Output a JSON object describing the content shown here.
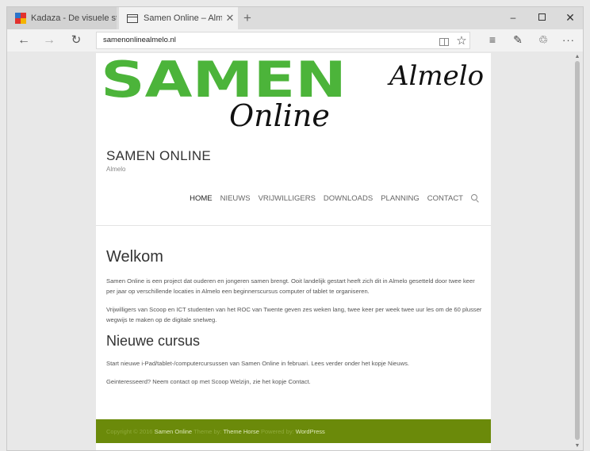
{
  "browser": {
    "tabs": [
      {
        "title": "Kadaza - De visuele startpag",
        "active": false
      },
      {
        "title": "Samen Online – Almelo",
        "active": true
      }
    ],
    "new_tab": "+",
    "url": "samenonlinealmelo.nl",
    "window_controls": {
      "minimize": "–",
      "close": "✕"
    }
  },
  "site": {
    "logo": {
      "big_text": "SAMEN",
      "script_text": "Online",
      "city_text": "Almelo"
    },
    "title": "SAMEN ONLINE",
    "tagline": "Almelo",
    "menu": [
      "HOME",
      "NIEUWS",
      "VRIJWILLIGERS",
      "DOWNLOADS",
      "PLANNING",
      "CONTACT"
    ],
    "content": {
      "heading1": "Welkom",
      "para1": "Samen Online is een project dat ouderen en jongeren samen brengt. Ooit landelijk gestart heeft zich dit in Almelo  gesetteld door twee keer per jaar op verschillende locaties in Almelo een beginnerscursus computer of tablet te organiseren.",
      "para2": "Vrijwilligers van Scoop en ICT studenten van het ROC van Twente geven zes weken lang, twee keer per week twee uur les om de 60 plusser wegwijs te maken op de digitale snelweg.",
      "heading2": "Nieuwe cursus",
      "para3": "Start nieuwe i-Pad/tablet-/computercursussen van Samen Online in februari. Lees verder onder het kopje Nieuws.",
      "para4": "Geinteresseerd? Neem contact op met Scoop Welzijn, zie het kopje Contact."
    },
    "footer": {
      "prefix": "Copyright © 2016",
      "site_link": "Samen Online",
      "theme_by": "Theme by:",
      "theme_link": "Theme Horse",
      "powered_by": "Powered by:",
      "wp_link": "WordPress"
    }
  },
  "colors": {
    "logo_green": "#4cb43a",
    "footer_green": "#6b8a0a"
  }
}
